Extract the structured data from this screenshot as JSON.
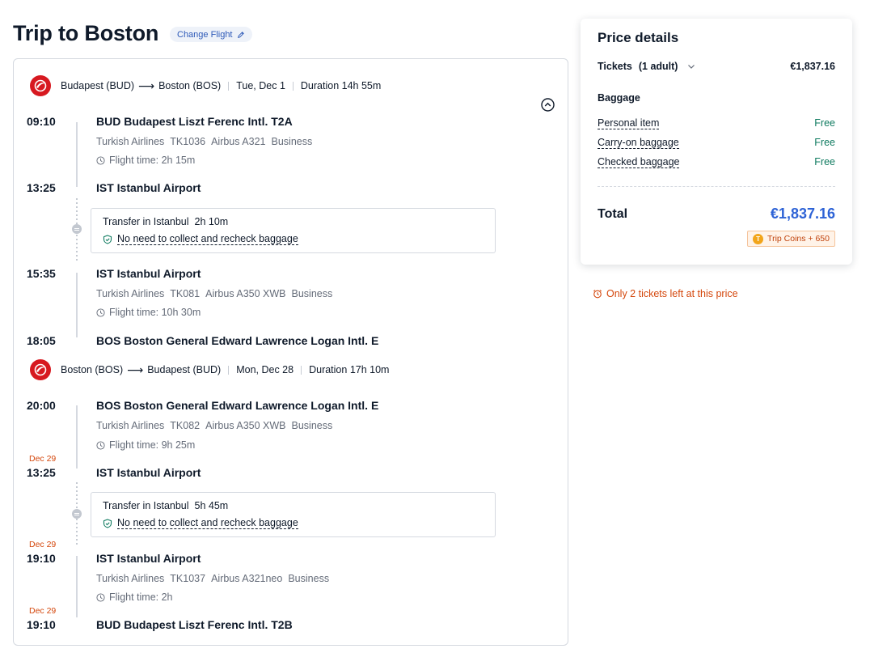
{
  "page": {
    "title": "Trip to Boston",
    "change_flight": "Change Flight"
  },
  "colors": {
    "brand_red": "#d71920",
    "accent_blue": "#2e63d6",
    "free_green": "#0e7a5f",
    "warning_orange": "#d4470c"
  },
  "outbound": {
    "route_from": "Budapest (BUD)",
    "route_to": "Boston (BOS)",
    "date": "Tue, Dec 1",
    "duration": "Duration 14h 55m",
    "seg1": {
      "dep_time": "09:10",
      "dep_station": "BUD Budapest Liszt Ferenc Intl. T2A",
      "airline": "Turkish Airlines",
      "flight_no": "TK1036",
      "aircraft": "Airbus A321",
      "cabin": "Business",
      "flight_time": "Flight time: 2h 15m",
      "arr_time": "13:25",
      "arr_station": "IST Istanbul Airport"
    },
    "transfer": {
      "label": "Transfer in Istanbul",
      "duration": "2h 10m",
      "baggage": "No need to collect and recheck baggage"
    },
    "seg2": {
      "dep_time": "15:35",
      "dep_station": "IST Istanbul Airport",
      "airline": "Turkish Airlines",
      "flight_no": "TK081",
      "aircraft": "Airbus A350 XWB",
      "cabin": "Business",
      "flight_time": "Flight time: 10h 30m",
      "arr_time": "18:05",
      "arr_station": "BOS Boston General Edward Lawrence Logan Intl. E"
    }
  },
  "inbound": {
    "route_from": "Boston (BOS)",
    "route_to": "Budapest (BUD)",
    "date": "Mon, Dec 28",
    "duration": "Duration 17h 10m",
    "seg1": {
      "dep_time": "20:00",
      "dep_station": "BOS Boston General Edward Lawrence Logan Intl. E",
      "airline": "Turkish Airlines",
      "flight_no": "TK082",
      "aircraft": "Airbus A350 XWB",
      "cabin": "Business",
      "flight_time": "Flight time: 9h 25m",
      "arr_date": "Dec 29",
      "arr_time": "13:25",
      "arr_station": "IST Istanbul Airport"
    },
    "transfer": {
      "label": "Transfer in Istanbul",
      "duration": "5h 45m",
      "baggage": "No need to collect and recheck baggage"
    },
    "seg2": {
      "dep_date": "Dec 29",
      "dep_time": "19:10",
      "dep_station": "IST Istanbul Airport",
      "airline": "Turkish Airlines",
      "flight_no": "TK1037",
      "aircraft": "Airbus A321neo",
      "cabin": "Business",
      "flight_time": "Flight time: 2h",
      "arr_date": "Dec 29",
      "arr_time": "19:10",
      "arr_station": "BUD Budapest Liszt Ferenc Intl. T2B"
    }
  },
  "price": {
    "title": "Price details",
    "tickets_label": "Tickets",
    "tickets_qty": "(1 adult)",
    "tickets_value": "€1,837.16",
    "baggage_title": "Baggage",
    "baggage": [
      {
        "name": "Personal item",
        "value": "Free"
      },
      {
        "name": "Carry-on baggage",
        "value": "Free"
      },
      {
        "name": "Checked baggage",
        "value": "Free"
      }
    ],
    "total_label": "Total",
    "total_value": "€1,837.16",
    "coins": "Trip Coins + 650"
  },
  "alert": "Only 2 tickets left at this price"
}
